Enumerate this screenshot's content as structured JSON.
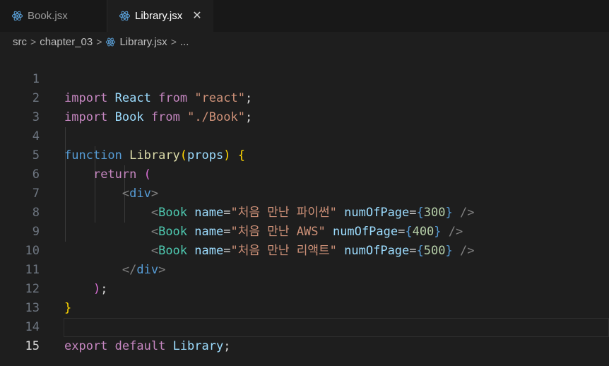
{
  "tabs": [
    {
      "label": "Book.jsx",
      "icon": "react-icon",
      "active": false
    },
    {
      "label": "Library.jsx",
      "icon": "react-icon",
      "active": true,
      "close": "✕"
    }
  ],
  "breadcrumb": {
    "folder": "src",
    "subfolder": "chapter_03",
    "file": "Library.jsx",
    "more": "..."
  },
  "editor": {
    "current_line": 15,
    "lines": [
      {
        "num": "1"
      },
      {
        "num": "2"
      },
      {
        "num": "3"
      },
      {
        "num": "4"
      },
      {
        "num": "5"
      },
      {
        "num": "6"
      },
      {
        "num": "7"
      },
      {
        "num": "8"
      },
      {
        "num": "9"
      },
      {
        "num": "10"
      },
      {
        "num": "11"
      },
      {
        "num": "12"
      },
      {
        "num": "13"
      },
      {
        "num": "14"
      },
      {
        "num": "15"
      }
    ],
    "tokens": {
      "import": "import",
      "from": "from",
      "react_id": "React",
      "react_str": "\"react\"",
      "book_id": "Book",
      "book_str": "\"./Book\"",
      "function": "function",
      "library": "Library",
      "props": "props",
      "return": "return",
      "div": "div",
      "book_tag": "Book",
      "name_attr": "name",
      "pages_attr": "numOfPage",
      "names": [
        "\"처음 만난 파이썬\"",
        "\"처음 만난 AWS\"",
        "\"처음 만난 리액트\""
      ],
      "pages": [
        "300",
        "400",
        "500"
      ],
      "export": "export",
      "default": "default",
      "semicolon": ";"
    }
  },
  "colors": {
    "keyword": "#c586c0",
    "function": "#dcdcaa",
    "string": "#ce9178",
    "tag": "#4ec9b0",
    "attribute": "#9cdcfe",
    "number": "#b5cea8",
    "background": "#1e1e1e"
  }
}
